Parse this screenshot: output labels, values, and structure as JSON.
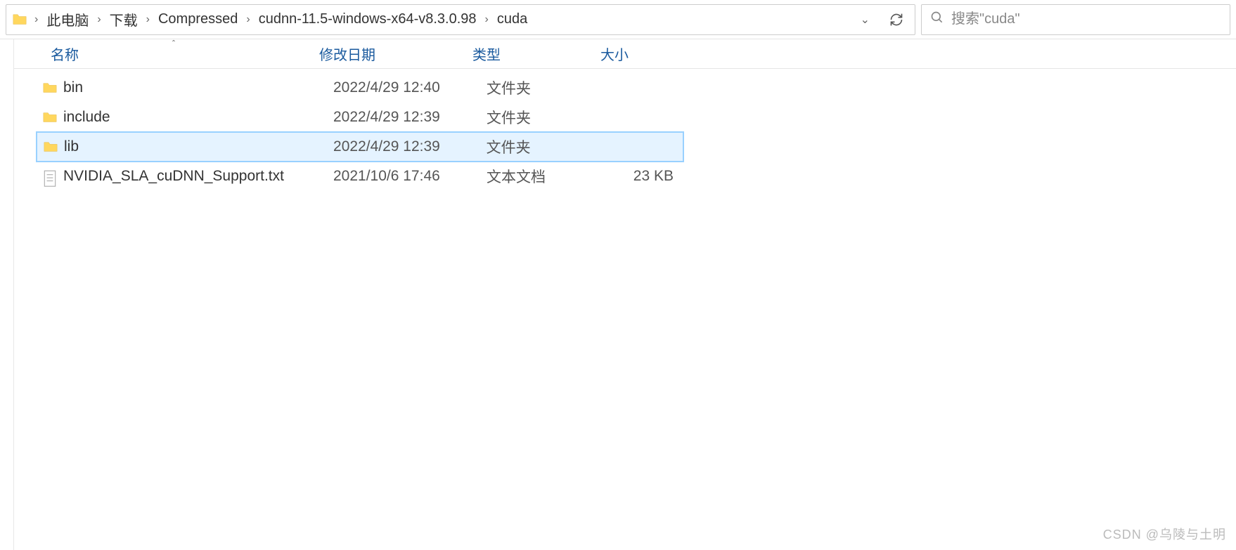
{
  "breadcrumb": {
    "items": [
      "此电脑",
      "下载",
      "Compressed",
      "cudnn-11.5-windows-x64-v8.3.0.98",
      "cuda"
    ]
  },
  "search": {
    "placeholder": "搜索\"cuda\""
  },
  "columns": {
    "name": "名称",
    "date": "修改日期",
    "type": "类型",
    "size": "大小"
  },
  "files": [
    {
      "name": "bin",
      "date": "2022/4/29 12:40",
      "type": "文件夹",
      "size": "",
      "icon": "folder",
      "selected": false
    },
    {
      "name": "include",
      "date": "2022/4/29 12:39",
      "type": "文件夹",
      "size": "",
      "icon": "folder",
      "selected": false
    },
    {
      "name": "lib",
      "date": "2022/4/29 12:39",
      "type": "文件夹",
      "size": "",
      "icon": "folder",
      "selected": true
    },
    {
      "name": "NVIDIA_SLA_cuDNN_Support.txt",
      "date": "2021/10/6 17:46",
      "type": "文本文档",
      "size": "23 KB",
      "icon": "text",
      "selected": false
    }
  ],
  "watermark": "CSDN @乌陵与土明"
}
